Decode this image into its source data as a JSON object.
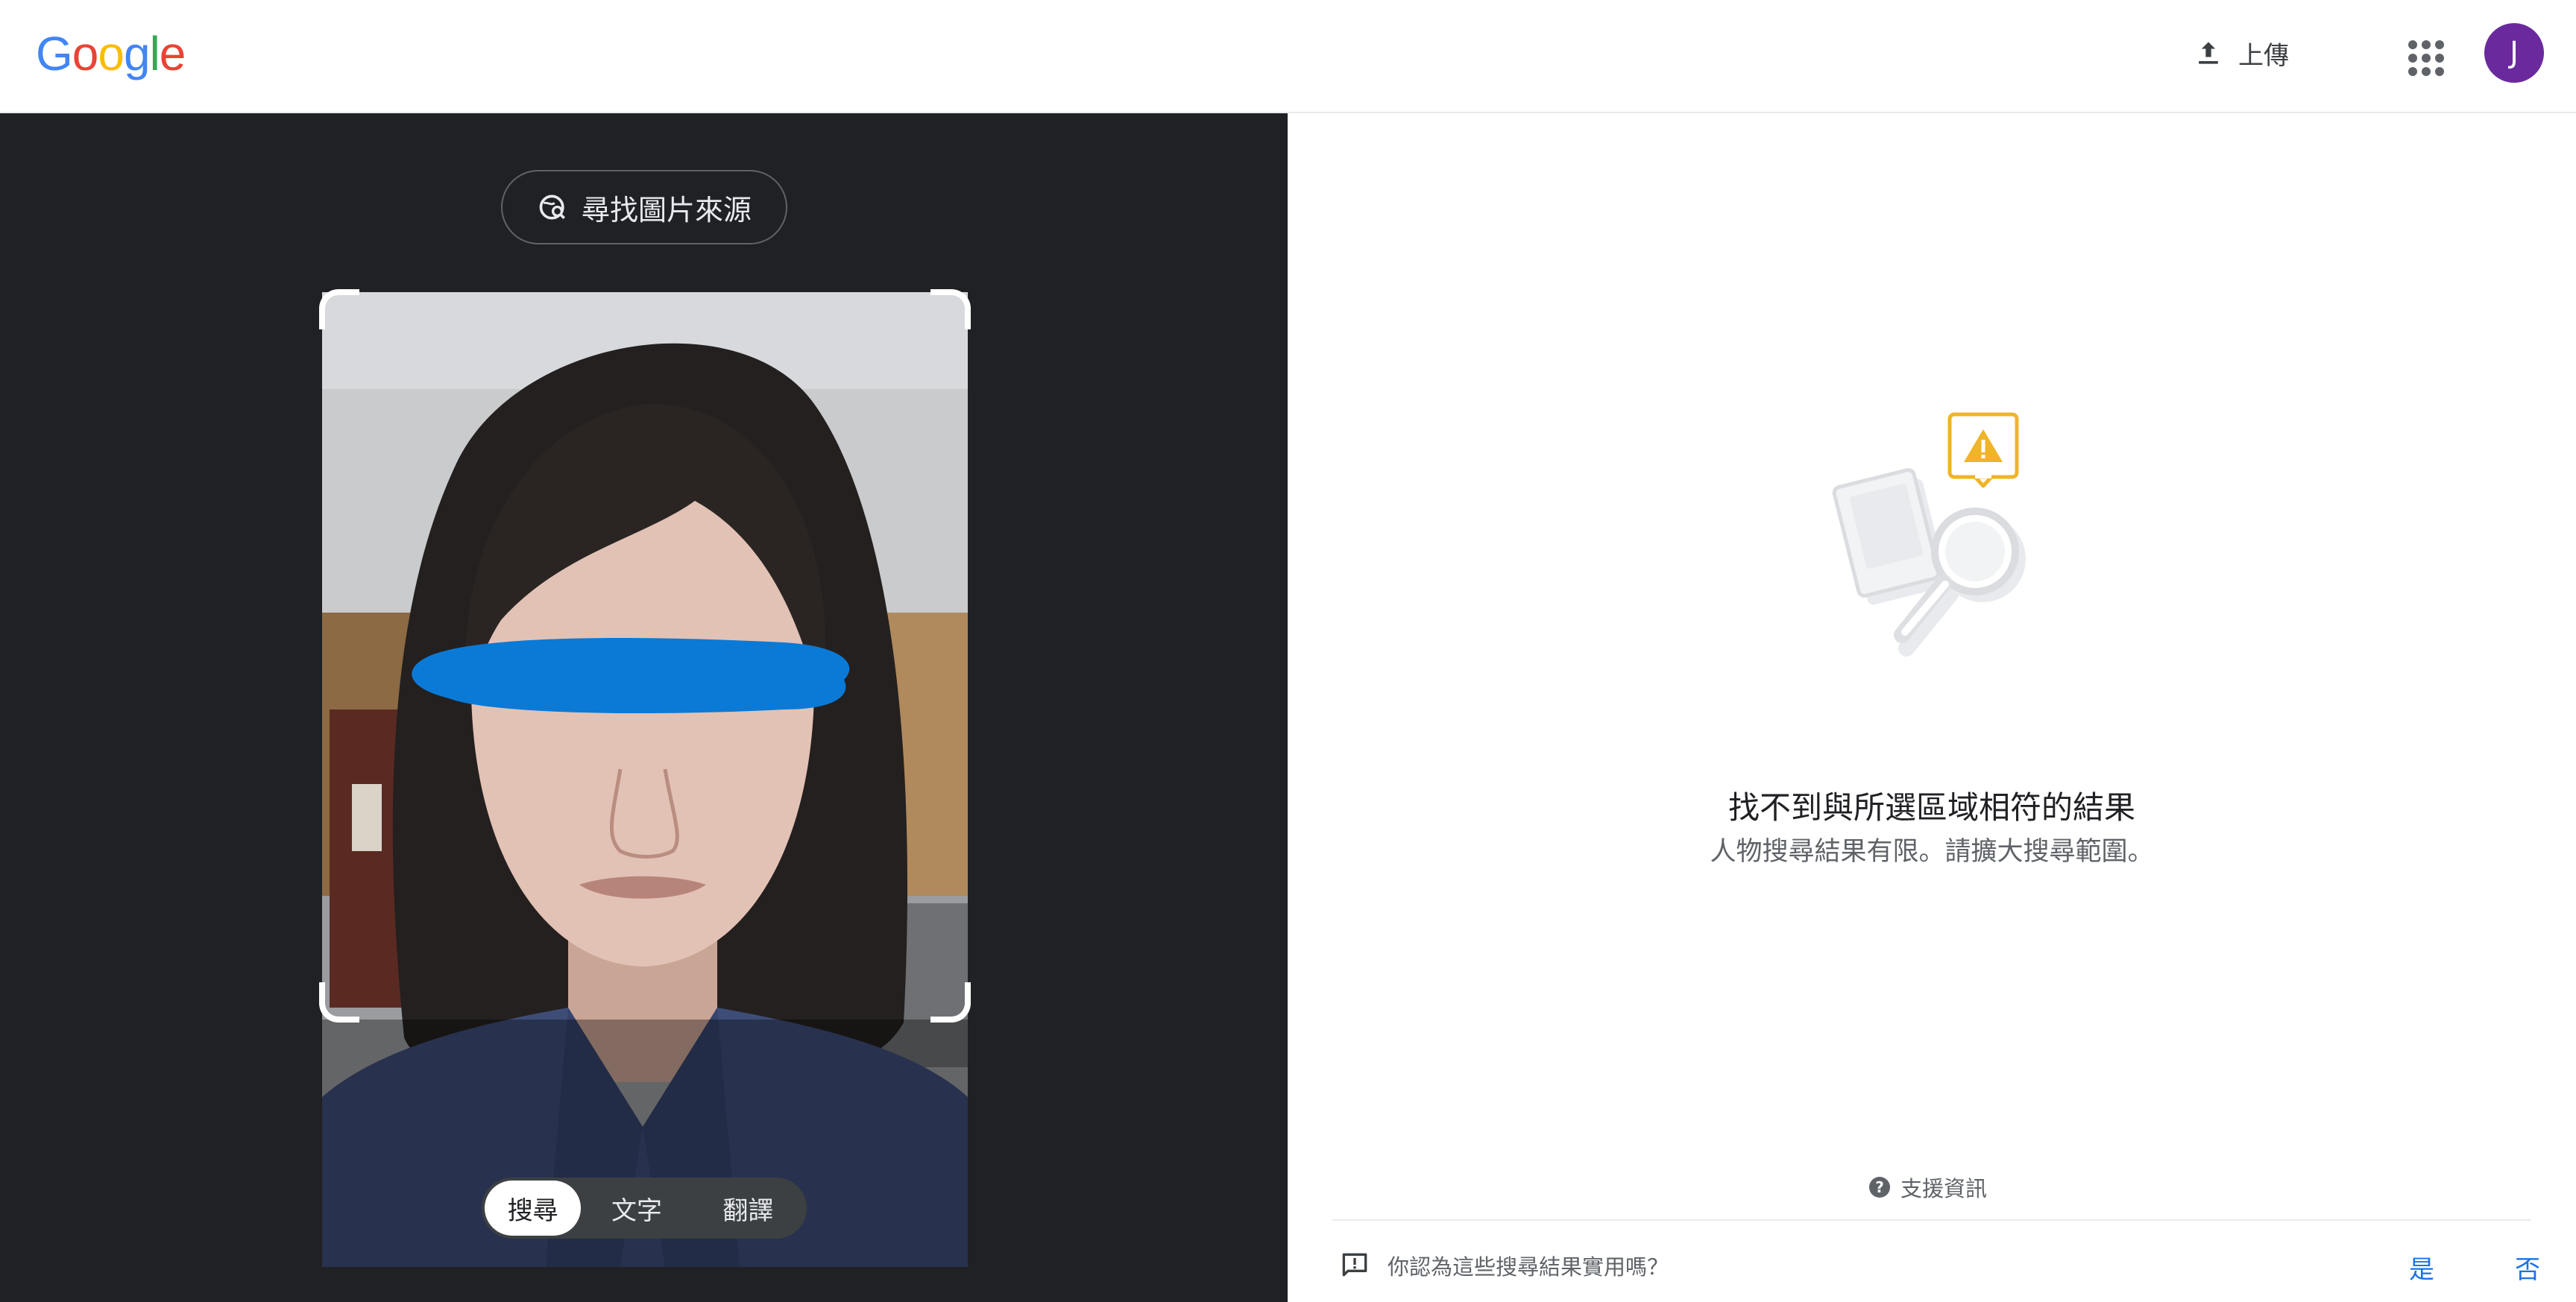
{
  "header": {
    "logo_text": "Google",
    "upload_label": "上傳",
    "avatar_letter": "J",
    "avatar_color": "#6a2a9e"
  },
  "lens": {
    "find_source_label": "尋找圖片來源",
    "tabs": [
      {
        "label": "搜尋",
        "active": true
      },
      {
        "label": "文字",
        "active": false
      },
      {
        "label": "翻譯",
        "active": false
      }
    ]
  },
  "results": {
    "title": "找不到與所選區域相符的結果",
    "subtitle": "人物搜尋結果有限。請擴大搜尋範圍。",
    "support_label": "支援資訊",
    "feedback_question": "你認為這些搜尋結果實用嗎？",
    "yes_label": "是",
    "no_label": "否"
  },
  "colors": {
    "accent_blue": "#1a73e8",
    "panel_dark": "#202124",
    "warning_yellow": "#f0b429"
  },
  "icons": {
    "upload": "upload-icon",
    "apps": "apps-grid-icon",
    "find_source": "image-search-icon",
    "support": "help-circle-icon",
    "feedback": "feedback-icon"
  }
}
